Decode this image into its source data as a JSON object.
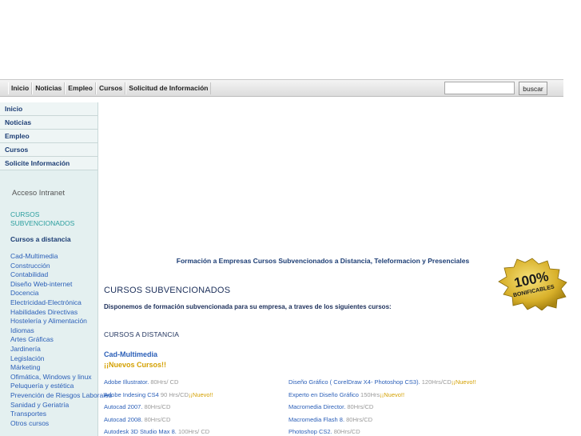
{
  "topnav": [
    "Inicio",
    "Noticias",
    "Empleo",
    "Cursos",
    "Solicitud de Información"
  ],
  "search": {
    "button": "buscar",
    "value": ""
  },
  "sidebar": {
    "menu": [
      "Inicio",
      "Noticias",
      "Empleo",
      "Cursos",
      "Solicite Información"
    ],
    "intranet": "Acceso Intranet",
    "cat_title": "CURSOS SUBVENCIONADOS",
    "cat_sub": "Cursos a distancia",
    "links": [
      "Cad-Multimedia",
      "Construcción",
      "Contabilidad",
      "Diseño Web-internet",
      "Docencia",
      "Electricidad-Electrónica",
      "Habilidades Directivas",
      "Hostelería y Alimentación",
      "Idiomas",
      "Artes Gráficas",
      "Jardinería",
      "Legislación",
      "Márketing",
      "Ofimática, Windows y linux",
      "Peluquería y estética",
      "Prevención de Riesgos Laborales",
      "Sanidad y Geriatría",
      "Transportes",
      "Otros cursos"
    ]
  },
  "main": {
    "tagline": "Formación a Empresas Cursos Subvencionados a Distancia, Teleformacion y Presenciales",
    "heading": "CURSOS SUBVENCIONADOS",
    "intro": "Disponemos de formación subvencionada para su empresa, a traves de los siguientes cursos:",
    "section": "CURSOS A DISTANCIA",
    "category": "Cad-Multimedia",
    "new_courses": "¡¡Nuevos Cursos!!",
    "courses_left": [
      {
        "name": "Adobe Illustrator.",
        "detail": " 80Hrs/ CD",
        "new": ""
      },
      {
        "name": "Adobe Indesing CS4",
        "detail": " 90 Hrs/CD",
        "new": "¡¡Nuevo!!"
      },
      {
        "name": "Autocad 2007.",
        "detail": " 80Hrs/CD",
        "new": ""
      },
      {
        "name": "Autocad 2008.",
        "detail": " 80Hrs/CD",
        "new": ""
      },
      {
        "name": "Autodesk 3D Studio Max 8.",
        "detail": " 100Hrs/ CD",
        "new": ""
      }
    ],
    "courses_right": [
      {
        "name": "Diseño Gráfico ( CorelDraw X4- Photoshop CS3).",
        "detail": " 120Hrs/CD",
        "new": "¡¡Nuevo!!"
      },
      {
        "name": "Experto en Diseño Gráfico",
        "detail": " 150Hrs",
        "new": "¡¡Nuevo!!"
      },
      {
        "name": "Macromedia Director.",
        "detail": " 80Hrs/CD",
        "new": ""
      },
      {
        "name": "Macromedia Flash 8.",
        "detail": " 80Hrs/CD",
        "new": ""
      },
      {
        "name": "Photoshop CS2.",
        "detail": " 80Hrs/CD",
        "new": ""
      }
    ],
    "seal": {
      "big": "100%",
      "small": "BONIFICABLES"
    }
  }
}
